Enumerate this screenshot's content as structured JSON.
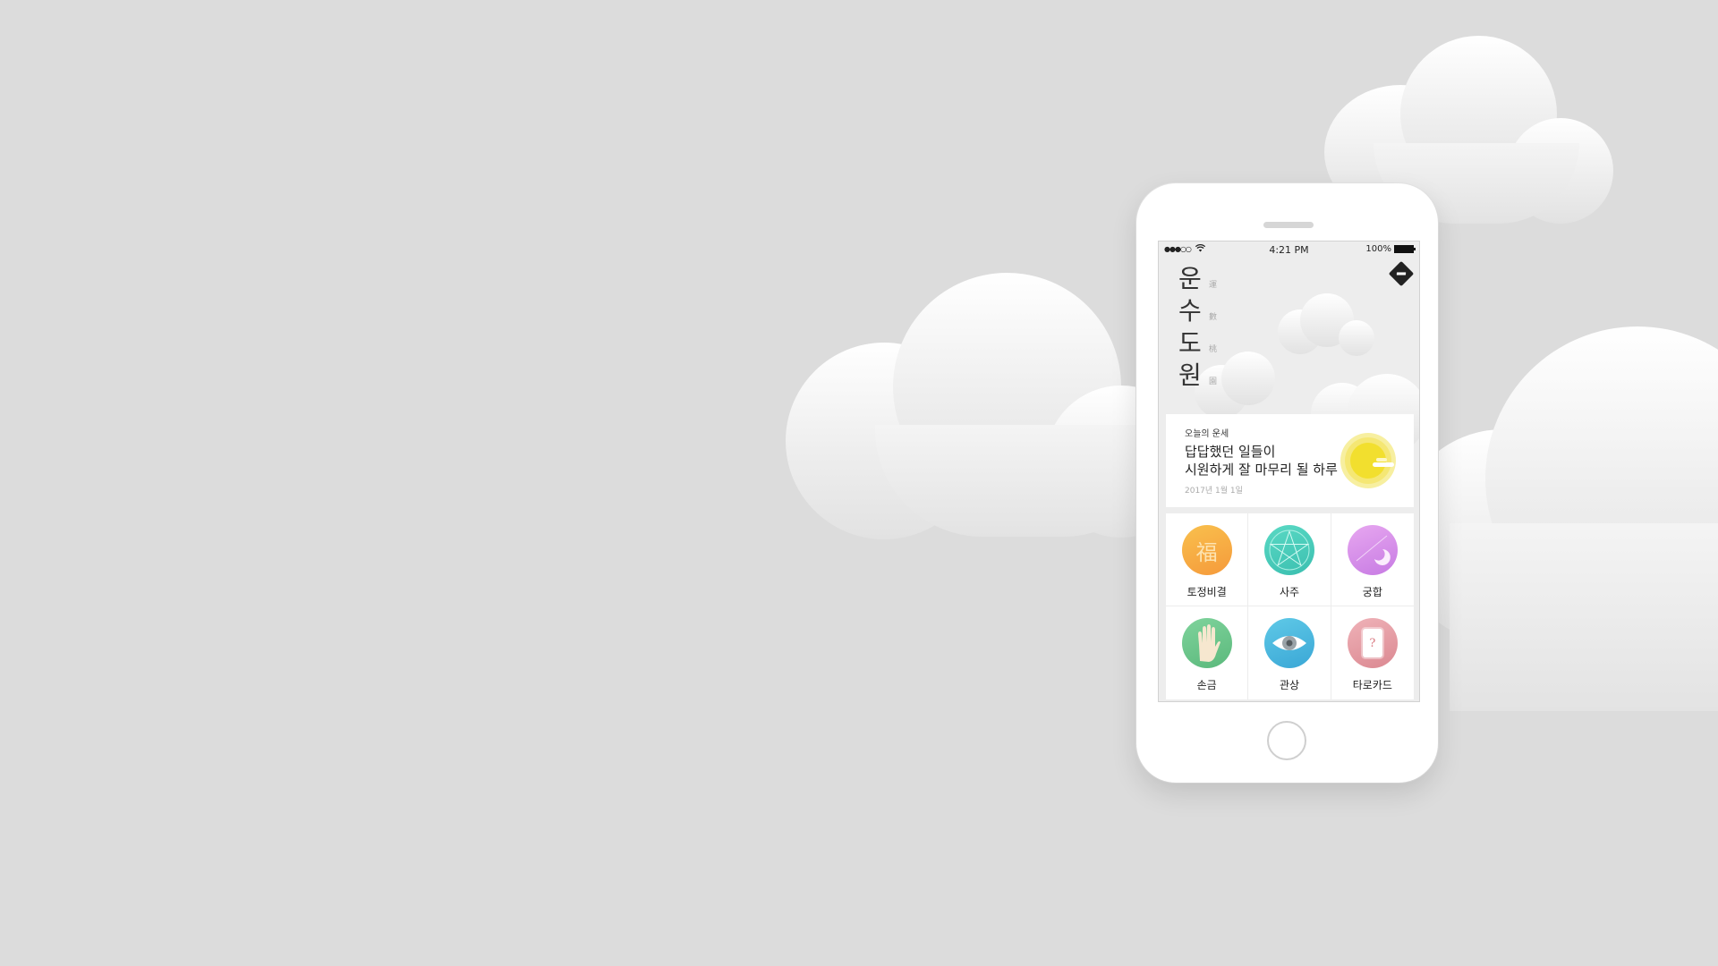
{
  "statusbar": {
    "signal": "●●●○○",
    "time": "4:21 PM",
    "battery": "100%"
  },
  "app": {
    "title_chars": [
      "운",
      "수",
      "도",
      "원"
    ],
    "title_hanja": [
      "運",
      "數",
      "桃",
      "園"
    ]
  },
  "fortune": {
    "label": "오늘의 운세",
    "line1": "답답했던 일들이",
    "line2": "시원하게 잘 마무리 될 하루",
    "date": "2017년 1월 1일"
  },
  "menu": {
    "items": [
      {
        "label": "토정비결",
        "icon": "bok-character-icon",
        "glyph": "福"
      },
      {
        "label": "사주",
        "icon": "pentagram-icon"
      },
      {
        "label": "궁합",
        "icon": "crescent-moon-icon"
      },
      {
        "label": "손금",
        "icon": "palm-hand-icon"
      },
      {
        "label": "관상",
        "icon": "eye-icon"
      },
      {
        "label": "타로카드",
        "icon": "tarot-card-icon",
        "glyph": "?"
      }
    ]
  },
  "colors": {
    "background": "#dcdcdc",
    "sun": "#f2df2e",
    "tojeong": "#f6a93f",
    "saju": "#43cbb5",
    "gunghap": "#d58bea",
    "songeum": "#6bc58a",
    "gwansang": "#4bb6dc",
    "tarot": "#e59aa3"
  }
}
